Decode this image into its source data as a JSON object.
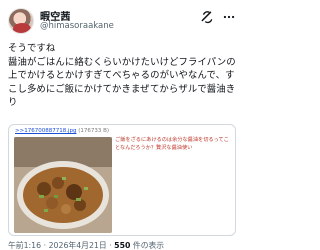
{
  "author": {
    "display_name": "暇空茜",
    "handle": "@himasoraakane",
    "avatar_icon": "avatar-image",
    "grok_icon": "grok-icon",
    "more_icon": "more-horizontal-icon"
  },
  "tweet": {
    "text": "そうですね\n醤油がごはんに絡むくらいかけたいけどフライパンの上でかけるとかけすぎてべちゃるのがいやなんで、すこし多めにご飯にかけてかきまぜてからザルで醤油きり"
  },
  "quote": {
    "number": ">>176700887718.jpg",
    "meta": "(176733 B)",
    "text": "ご飯をざるにあけるのは余分な醤油を切るってことなんだろうか？贅沢な醤油使い"
  },
  "meta": {
    "time": "午前1:16",
    "separator1": "·",
    "date": "2026年4月21日",
    "separator2": "·",
    "views_count": "550",
    "views_label": "件の表示"
  },
  "colors": {
    "text": "#0f1419",
    "secondary": "#536471",
    "quote_text": "#c0392b",
    "link": "#1a4fd6",
    "border": "#cfd9de"
  }
}
